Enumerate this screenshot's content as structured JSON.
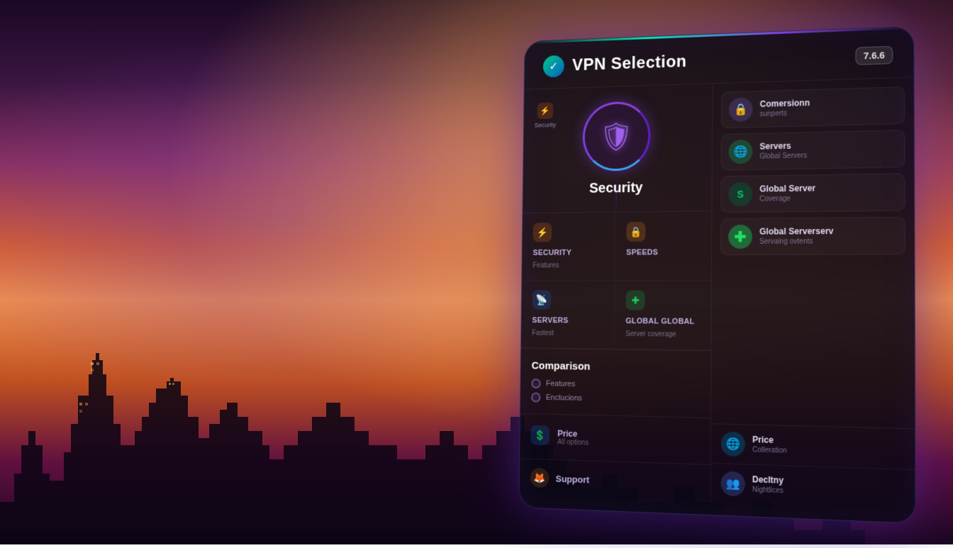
{
  "app": {
    "title": "VPN Selection",
    "version": "7.6.6"
  },
  "header": {
    "icon_symbol": "✓",
    "title": "VPN Selection",
    "version": "7.6.6"
  },
  "security_hero": {
    "shield_symbol": "🛡",
    "title": "Security",
    "left_label": "Security",
    "left_icon": "⚡"
  },
  "sub_items": [
    {
      "icon": "⚡",
      "icon_class": "icon-orange",
      "label": "Security",
      "desc": "Features"
    },
    {
      "icon": "🔒",
      "icon_class": "icon-orange-lock",
      "label": "Speeds",
      "desc": ""
    },
    {
      "icon": "📡",
      "icon_class": "icon-blue",
      "label": "Servers",
      "desc": "Fastest"
    },
    {
      "icon": "✚",
      "icon_class": "icon-green",
      "label": "Global global",
      "desc": "Server coverage"
    }
  ],
  "comparison": {
    "title": "Comparison",
    "items": [
      {
        "label": "Features"
      },
      {
        "label": "Enctucions"
      }
    ],
    "price_label": "Price",
    "price_desc": "All options",
    "support_label": "Support"
  },
  "right_items": [
    {
      "icon": "🔒",
      "icon_class": "right-icon-lock",
      "title": "Comersionn",
      "desc": "sunperts"
    },
    {
      "icon": "🌐",
      "icon_class": "right-icon-globe",
      "title": "Servers",
      "desc": "Global Servers"
    },
    {
      "icon": "S",
      "icon_class": "right-icon-shield",
      "title": "Global Server",
      "desc": "Coverage"
    },
    {
      "icon": "✚",
      "icon_class": "right-icon-plus",
      "title": "Global Serverserv",
      "desc": "Servaing ovtents"
    }
  ],
  "right_bottom": {
    "price_icon": "🌐",
    "price_icon_class": "right-icon-globe2",
    "price_title": "Price",
    "price_desc": "Colleration",
    "support_icon": "👥",
    "support_icon_class": "right-icon-people",
    "support_title": "Decltny",
    "support_desc": "Nightlices"
  }
}
